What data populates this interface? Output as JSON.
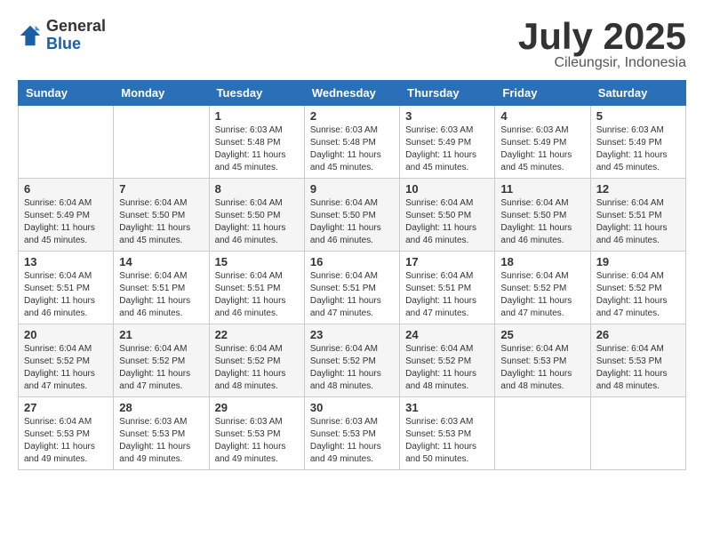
{
  "logo": {
    "general": "General",
    "blue": "Blue"
  },
  "title": {
    "month": "July 2025",
    "location": "Cileungsir, Indonesia"
  },
  "weekdays": [
    "Sunday",
    "Monday",
    "Tuesday",
    "Wednesday",
    "Thursday",
    "Friday",
    "Saturday"
  ],
  "rows": [
    [
      {
        "day": "",
        "info": ""
      },
      {
        "day": "",
        "info": ""
      },
      {
        "day": "1",
        "info": "Sunrise: 6:03 AM\nSunset: 5:48 PM\nDaylight: 11 hours and 45 minutes."
      },
      {
        "day": "2",
        "info": "Sunrise: 6:03 AM\nSunset: 5:48 PM\nDaylight: 11 hours and 45 minutes."
      },
      {
        "day": "3",
        "info": "Sunrise: 6:03 AM\nSunset: 5:49 PM\nDaylight: 11 hours and 45 minutes."
      },
      {
        "day": "4",
        "info": "Sunrise: 6:03 AM\nSunset: 5:49 PM\nDaylight: 11 hours and 45 minutes."
      },
      {
        "day": "5",
        "info": "Sunrise: 6:03 AM\nSunset: 5:49 PM\nDaylight: 11 hours and 45 minutes."
      }
    ],
    [
      {
        "day": "6",
        "info": "Sunrise: 6:04 AM\nSunset: 5:49 PM\nDaylight: 11 hours and 45 minutes."
      },
      {
        "day": "7",
        "info": "Sunrise: 6:04 AM\nSunset: 5:50 PM\nDaylight: 11 hours and 45 minutes."
      },
      {
        "day": "8",
        "info": "Sunrise: 6:04 AM\nSunset: 5:50 PM\nDaylight: 11 hours and 46 minutes."
      },
      {
        "day": "9",
        "info": "Sunrise: 6:04 AM\nSunset: 5:50 PM\nDaylight: 11 hours and 46 minutes."
      },
      {
        "day": "10",
        "info": "Sunrise: 6:04 AM\nSunset: 5:50 PM\nDaylight: 11 hours and 46 minutes."
      },
      {
        "day": "11",
        "info": "Sunrise: 6:04 AM\nSunset: 5:50 PM\nDaylight: 11 hours and 46 minutes."
      },
      {
        "day": "12",
        "info": "Sunrise: 6:04 AM\nSunset: 5:51 PM\nDaylight: 11 hours and 46 minutes."
      }
    ],
    [
      {
        "day": "13",
        "info": "Sunrise: 6:04 AM\nSunset: 5:51 PM\nDaylight: 11 hours and 46 minutes."
      },
      {
        "day": "14",
        "info": "Sunrise: 6:04 AM\nSunset: 5:51 PM\nDaylight: 11 hours and 46 minutes."
      },
      {
        "day": "15",
        "info": "Sunrise: 6:04 AM\nSunset: 5:51 PM\nDaylight: 11 hours and 46 minutes."
      },
      {
        "day": "16",
        "info": "Sunrise: 6:04 AM\nSunset: 5:51 PM\nDaylight: 11 hours and 47 minutes."
      },
      {
        "day": "17",
        "info": "Sunrise: 6:04 AM\nSunset: 5:51 PM\nDaylight: 11 hours and 47 minutes."
      },
      {
        "day": "18",
        "info": "Sunrise: 6:04 AM\nSunset: 5:52 PM\nDaylight: 11 hours and 47 minutes."
      },
      {
        "day": "19",
        "info": "Sunrise: 6:04 AM\nSunset: 5:52 PM\nDaylight: 11 hours and 47 minutes."
      }
    ],
    [
      {
        "day": "20",
        "info": "Sunrise: 6:04 AM\nSunset: 5:52 PM\nDaylight: 11 hours and 47 minutes."
      },
      {
        "day": "21",
        "info": "Sunrise: 6:04 AM\nSunset: 5:52 PM\nDaylight: 11 hours and 47 minutes."
      },
      {
        "day": "22",
        "info": "Sunrise: 6:04 AM\nSunset: 5:52 PM\nDaylight: 11 hours and 48 minutes."
      },
      {
        "day": "23",
        "info": "Sunrise: 6:04 AM\nSunset: 5:52 PM\nDaylight: 11 hours and 48 minutes."
      },
      {
        "day": "24",
        "info": "Sunrise: 6:04 AM\nSunset: 5:52 PM\nDaylight: 11 hours and 48 minutes."
      },
      {
        "day": "25",
        "info": "Sunrise: 6:04 AM\nSunset: 5:53 PM\nDaylight: 11 hours and 48 minutes."
      },
      {
        "day": "26",
        "info": "Sunrise: 6:04 AM\nSunset: 5:53 PM\nDaylight: 11 hours and 48 minutes."
      }
    ],
    [
      {
        "day": "27",
        "info": "Sunrise: 6:04 AM\nSunset: 5:53 PM\nDaylight: 11 hours and 49 minutes."
      },
      {
        "day": "28",
        "info": "Sunrise: 6:03 AM\nSunset: 5:53 PM\nDaylight: 11 hours and 49 minutes."
      },
      {
        "day": "29",
        "info": "Sunrise: 6:03 AM\nSunset: 5:53 PM\nDaylight: 11 hours and 49 minutes."
      },
      {
        "day": "30",
        "info": "Sunrise: 6:03 AM\nSunset: 5:53 PM\nDaylight: 11 hours and 49 minutes."
      },
      {
        "day": "31",
        "info": "Sunrise: 6:03 AM\nSunset: 5:53 PM\nDaylight: 11 hours and 50 minutes."
      },
      {
        "day": "",
        "info": ""
      },
      {
        "day": "",
        "info": ""
      }
    ]
  ]
}
